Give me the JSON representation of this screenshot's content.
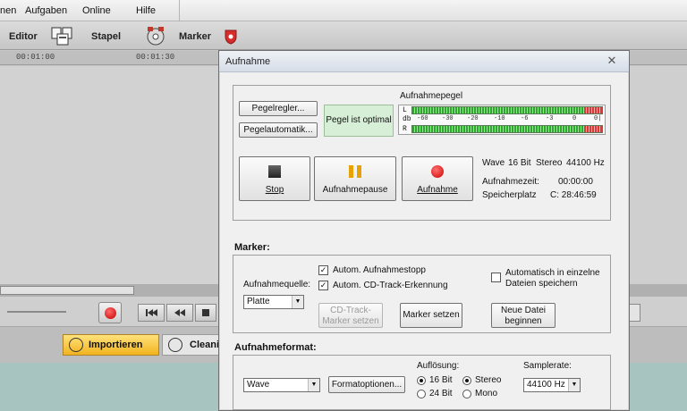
{
  "app": {
    "menu": [
      "nen",
      "Aufgaben",
      "Online",
      "Hilfe"
    ],
    "toolbar": {
      "editor_label": "Editor",
      "stapel_label": "Stapel",
      "marker_label": "Marker"
    },
    "ruler": [
      "00:01:00",
      "00:01:30"
    ],
    "status_tabs": {
      "import_label": "Importieren",
      "cleaning_label": "Cleanin"
    }
  },
  "dialog": {
    "title": "Aufnahme",
    "close_glyph": "✕",
    "level": {
      "pegelregler_label": "Pegelregler...",
      "pegelautomatik_label": "Pegelautomatik...",
      "status_text": "Pegel ist optimal",
      "meter_title": "Aufnahmepegel",
      "meter_left": "L",
      "meter_db": "db",
      "meter_right": "R",
      "meter_scale": [
        "-60",
        "-30",
        "-20",
        "-10",
        "-6",
        "-3",
        "0",
        "0|"
      ]
    },
    "transport": {
      "stop_label": "Stop",
      "pause_label": "Aufnahmepause",
      "record_label": "Aufnahme"
    },
    "info": {
      "format": "Wave",
      "bits": "16 Bit",
      "channels": "Stereo",
      "rate": "44100 Hz",
      "time_label": "Aufnahmezeit:",
      "time_value": "00:00:00",
      "space_label": "Speicherplatz",
      "space_value": "C: 28:46:59"
    },
    "marker": {
      "section_title": "Marker:",
      "source_label": "Aufnahmequelle:",
      "source_value": "Platte",
      "auto_stop_label": "Autom. Aufnahmestopp",
      "auto_stop_checked": true,
      "cd_track_label": "Autom. CD-Track-Erkennung",
      "cd_track_checked": true,
      "split_label_1": "Automatisch in einzelne",
      "split_label_2": "Dateien speichern",
      "split_checked": false,
      "cd_track_btn_1": "CD-Track-",
      "cd_track_btn_2": "Marker setzen",
      "set_marker_btn": "Marker setzen",
      "new_file_btn_1": "Neue Datei",
      "new_file_btn_2": "beginnen"
    },
    "format": {
      "section_title": "Aufnahmeformat:",
      "format_value": "Wave",
      "options_btn": "Formatoptionen...",
      "resolution_label": "Auflösung:",
      "bit16": "16 Bit",
      "bit24": "24 Bit",
      "bit16_selected": true,
      "stereo": "Stereo",
      "mono": "Mono",
      "stereo_selected": true,
      "samplerate_label": "Samplerate:",
      "samplerate_value": "44100 Hz"
    }
  }
}
